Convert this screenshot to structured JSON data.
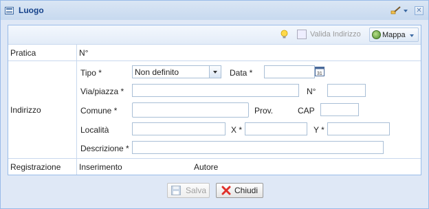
{
  "window": {
    "title": "Luogo",
    "icons": {
      "title": "form-icon",
      "tool": "paint-brush-icon",
      "close": "close-icon"
    }
  },
  "toolbar": {
    "help_icon": "light-bulb-icon",
    "valida_label": "Valida Indirizzo",
    "valida_icon": "validate-address-icon",
    "mappa_label": "Mappa",
    "mappa_icon": "globe-icon"
  },
  "form": {
    "pratica": {
      "label": "Pratica",
      "numero_label": "N°"
    },
    "indirizzo": {
      "label": "Indirizzo",
      "tipo_label": "Tipo *",
      "tipo_value": "Non definito",
      "data_label": "Data *",
      "data_value": "",
      "via_label": "Via/piazza *",
      "via_value": "",
      "civico_label": "N°",
      "civico_value": "",
      "comune_label": "Comune *",
      "comune_value": "",
      "prov_label": "Prov.",
      "cap_label": "CAP",
      "cap_value": "",
      "localita_label": "Località",
      "localita_value": "",
      "x_label": "X *",
      "x_value": "",
      "y_label": "Y *",
      "y_value": "",
      "descrizione_label": "Descrizione *",
      "descrizione_value": ""
    },
    "registrazione": {
      "label": "Registrazione",
      "inserimento_label": "Inserimento",
      "autore_label": "Autore"
    }
  },
  "footer": {
    "salva_label": "Salva",
    "salva_icon": "floppy-disk-icon",
    "chiudi_label": "Chiudi",
    "chiudi_icon": "red-x-icon"
  },
  "colors": {
    "title_text": "#15428b",
    "border": "#99bbe8",
    "window_bg": "#dfe8f6",
    "close_x": "#e0302a"
  }
}
